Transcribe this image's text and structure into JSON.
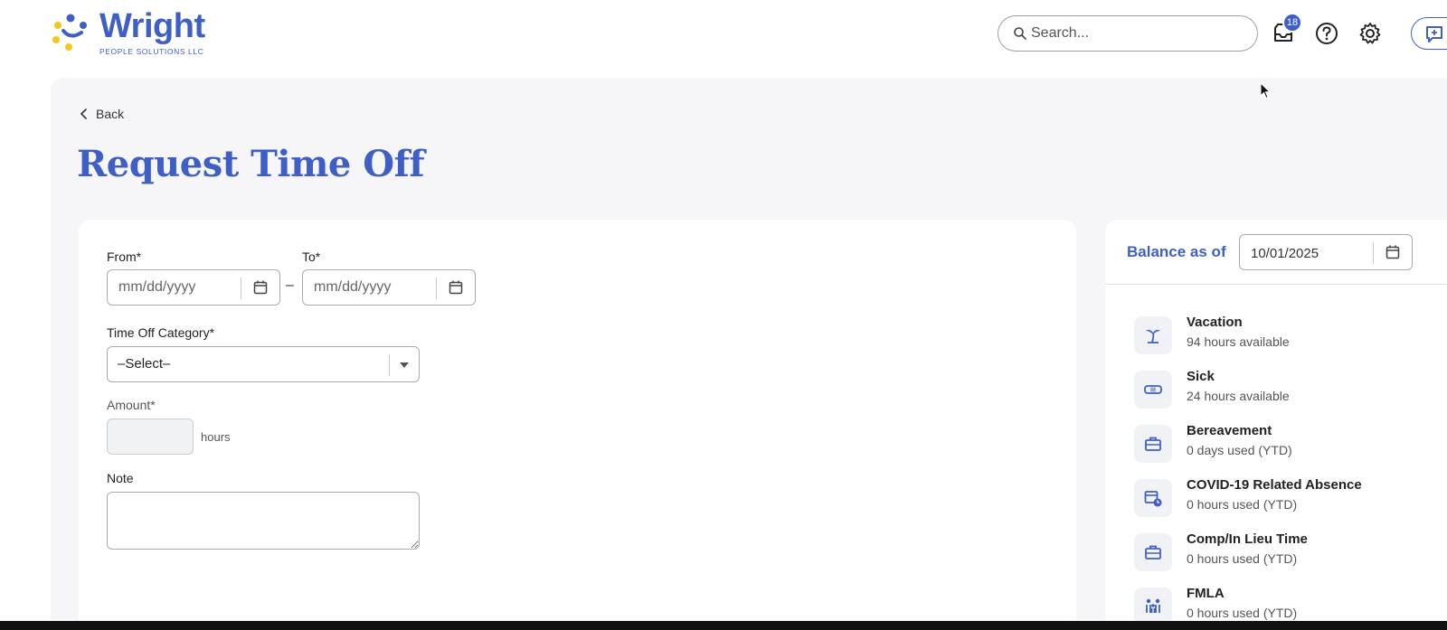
{
  "brand": {
    "name": "Wright",
    "tagline": "PEOPLE SOLUTIONS LLC",
    "accent": "#3f5fc6"
  },
  "header": {
    "search_placeholder": "Search...",
    "inbox_badge": "18",
    "icons": [
      "search-icon",
      "inbox-icon",
      "help-icon",
      "gear-icon",
      "chat-icon"
    ]
  },
  "page": {
    "back_label": "Back",
    "title": "Request Time Off"
  },
  "form": {
    "from_label": "From*",
    "from_placeholder": "mm/dd/yyyy",
    "range_separator": "–",
    "to_label": "To*",
    "to_placeholder": "mm/dd/yyyy",
    "category_label": "Time Off Category*",
    "category_value": "–Select–",
    "amount_label": "Amount*",
    "amount_unit": "hours",
    "note_label": "Note"
  },
  "balance": {
    "title": "Balance as of",
    "date": "10/01/2025",
    "items": [
      {
        "name": "Vacation",
        "detail": "94 hours available",
        "icon": "palm-tree-icon"
      },
      {
        "name": "Sick",
        "detail": "24 hours available",
        "icon": "bandage-icon"
      },
      {
        "name": "Bereavement",
        "detail": "0 days used (YTD)",
        "icon": "briefcase-icon"
      },
      {
        "name": "COVID-19 Related Absence",
        "detail": "0 hours used (YTD)",
        "icon": "calendar-clock-icon"
      },
      {
        "name": "Comp/In Lieu Time",
        "detail": "0 hours used (YTD)",
        "icon": "briefcase-icon"
      },
      {
        "name": "FMLA",
        "detail": "0 hours used (YTD)",
        "icon": "family-icon"
      }
    ]
  }
}
